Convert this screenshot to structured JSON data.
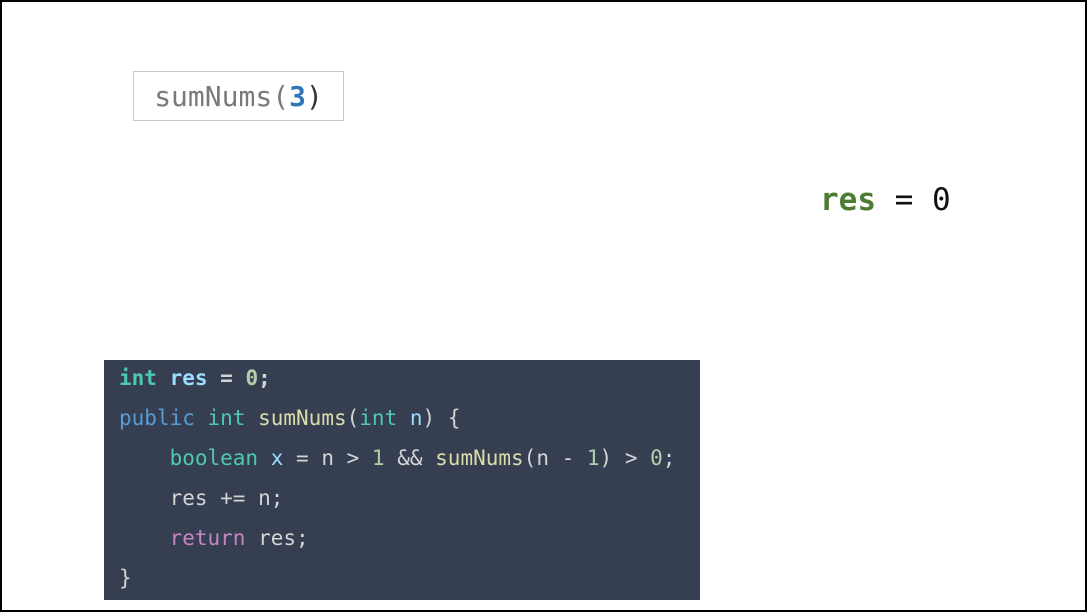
{
  "call": {
    "function": "sumNums",
    "open_paren": "(",
    "argument": "3",
    "close_paren": ")"
  },
  "state": {
    "variable": "res",
    "equals": " = ",
    "value": "0"
  },
  "code": {
    "lines": [
      {
        "tokens": [
          {
            "text": "int"
          },
          {
            "text": " "
          },
          {
            "text": "res"
          },
          {
            "text": " = "
          },
          {
            "text": "0"
          },
          {
            "text": ";"
          }
        ]
      },
      {
        "tokens": [
          {
            "text": "public"
          },
          {
            "text": " "
          },
          {
            "text": "int"
          },
          {
            "text": " "
          },
          {
            "text": "sumNums"
          },
          {
            "text": "("
          },
          {
            "text": "int"
          },
          {
            "text": " "
          },
          {
            "text": "n"
          },
          {
            "text": ") {"
          }
        ]
      },
      {
        "tokens": [
          {
            "text": "    "
          },
          {
            "text": "boolean"
          },
          {
            "text": " "
          },
          {
            "text": "x"
          },
          {
            "text": " = n > "
          },
          {
            "text": "1"
          },
          {
            "text": " && "
          },
          {
            "text": "sumNums"
          },
          {
            "text": "(n - "
          },
          {
            "text": "1"
          },
          {
            "text": ") > "
          },
          {
            "text": "0"
          },
          {
            "text": ";"
          }
        ]
      },
      {
        "tokens": [
          {
            "text": "    res += n;"
          }
        ]
      },
      {
        "tokens": [
          {
            "text": "    "
          },
          {
            "text": "return"
          },
          {
            "text": " res;"
          }
        ]
      },
      {
        "tokens": [
          {
            "text": "}"
          }
        ]
      }
    ]
  },
  "colors": {
    "argument": "#2f78b7",
    "res_variable": "#4c7b32",
    "code_background": "#353f51",
    "type_keyword": "#4ec9b0",
    "modifier_keyword": "#569cd6",
    "return_keyword": "#c586c0",
    "function_name": "#dcdcaa",
    "parameter": "#9cdcfe",
    "number": "#b5cea8"
  }
}
